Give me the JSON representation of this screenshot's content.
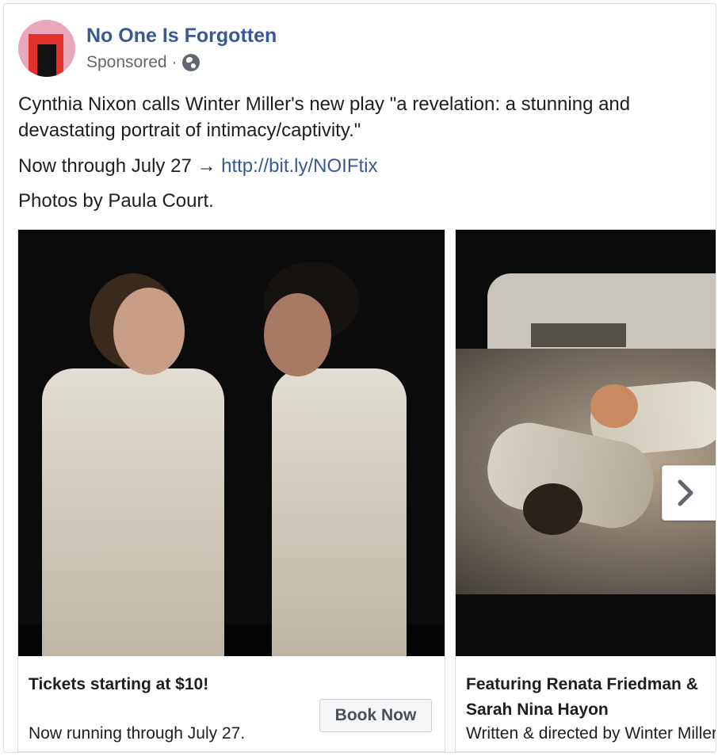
{
  "post": {
    "page_name": "No One Is Forgotten",
    "sponsored_label": "Sponsored",
    "separator": "·",
    "audience_icon": "globe-icon",
    "text_line1": "Cynthia Nixon calls Winter Miller's new play \"a revelation: a stunning and devastating portrait of intimacy/captivity.\"",
    "text_line2_prefix": "Now through July 27 → ",
    "text_line2_link": "http://bit.ly/NOIFtix",
    "text_line3": "Photos by Paula Court."
  },
  "carousel": {
    "cards": [
      {
        "title": "Tickets starting at $10!",
        "description": "Now running through July 27.",
        "cta": "Book Now"
      },
      {
        "title": "Featuring Renata Friedman & Sarah Nina Hayon",
        "description": "Written & directed by Winter Miller"
      }
    ],
    "next_icon": "chevron-right-icon"
  },
  "colors": {
    "link": "#385898",
    "text": "#1c1e21",
    "muted": "#606770",
    "border": "#dddfe2"
  }
}
